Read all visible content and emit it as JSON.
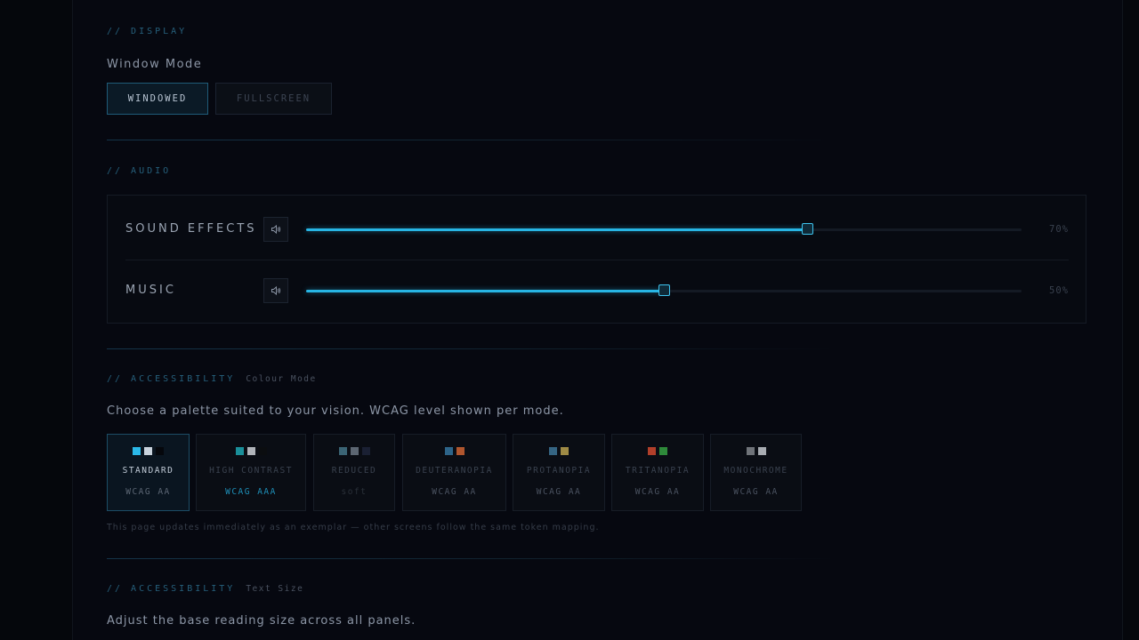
{
  "display": {
    "section_label": "// DISPLAY",
    "window_mode_label": "Window Mode",
    "modes": [
      {
        "label": "WINDOWED",
        "active": true
      },
      {
        "label": "FULLSCREEN",
        "active": false
      }
    ]
  },
  "audio": {
    "section_label": "// AUDIO",
    "channels": [
      {
        "name": "SOUND EFFECTS",
        "value": 70,
        "display": "70%",
        "icon": "speaker-icon"
      },
      {
        "name": "MUSIC",
        "value": 50,
        "display": "50%",
        "icon": "speaker-icon"
      }
    ]
  },
  "colour_mode": {
    "section_label": "// ACCESSIBILITY",
    "section_sub": "Colour Mode",
    "description": "Choose a palette suited to your vision. WCAG level shown per mode.",
    "palettes": [
      {
        "name": "STANDARD",
        "level": "WCAG AA",
        "colors": [
          "#2bb8e8",
          "#c9d3dd",
          "#05070c"
        ],
        "active": true
      },
      {
        "name": "HIGH CONTRAST",
        "level": "WCAG AAA",
        "colors": [
          "#1a8f9a",
          "#b0b4ba",
          "#0b0d10"
        ],
        "active": false
      },
      {
        "name": "REDUCED",
        "level": "soft",
        "colors": [
          "#3b6475",
          "#5c6672",
          "#1a2033"
        ],
        "active": false
      },
      {
        "name": "DEUTERANOPIA",
        "level": "WCAG AA",
        "colors": [
          "#2d6489",
          "#b0562e"
        ],
        "active": false
      },
      {
        "name": "PROTANOPIA",
        "level": "WCAG AA",
        "colors": [
          "#356583",
          "#9e8a45"
        ],
        "active": false
      },
      {
        "name": "TRITANOPIA",
        "level": "WCAG AA",
        "colors": [
          "#b13f2a",
          "#2e8a3a"
        ],
        "active": false
      },
      {
        "name": "MONOCHROME",
        "level": "WCAG AA",
        "colors": [
          "#6f7379",
          "#a8acb2"
        ],
        "active": false
      }
    ],
    "footnote": "This page updates immediately as an exemplar — other screens follow the same token mapping."
  },
  "text_size": {
    "section_label": "// ACCESSIBILITY",
    "section_sub": "Text Size",
    "description": "Adjust the base reading size across all panels."
  },
  "colors": {
    "accent": "#27b5e4",
    "background": "#05070c"
  }
}
